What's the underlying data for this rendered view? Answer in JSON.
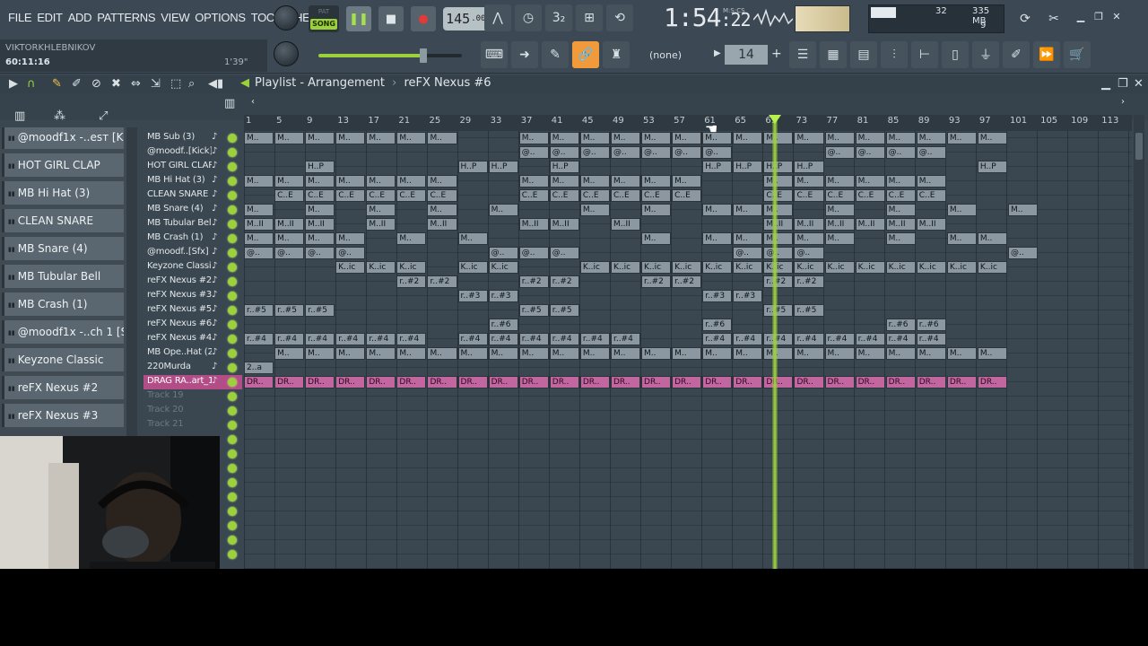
{
  "menu": [
    "FILE",
    "EDIT",
    "ADD",
    "PATTERNS",
    "VIEW",
    "OPTIONS",
    "TOOLS",
    "HELP"
  ],
  "hint": {
    "user": "VIKTORKHLEBNIKOV",
    "time": "60:11:16",
    "duration": "1'39\""
  },
  "transport": {
    "pat_label": "PAT",
    "song_label": "SONG",
    "tempo": "145",
    "tempo_decimal": ".000"
  },
  "clock": {
    "value": "1:54",
    "seconds": ":22",
    "sub": "M:S:CS"
  },
  "cpu": {
    "value": "32",
    "memory": "335 MB",
    "polyphony": "9"
  },
  "pattern_selector": "(none)",
  "step_value": "14",
  "master_volume": 0.73,
  "playlist": {
    "title": "Playlist - Arrangement",
    "separator": "›",
    "pattern": "reFX Nexus #6"
  },
  "ruler": [
    "1",
    "5",
    "9",
    "13",
    "17",
    "21",
    "25",
    "29",
    "33",
    "37",
    "41",
    "45",
    "49",
    "53",
    "57",
    "61",
    "65",
    "69",
    "73",
    "77",
    "81",
    "85",
    "89",
    "93",
    "97",
    "101",
    "105",
    "109",
    "113"
  ],
  "picker": [
    "@moodf1x -..esт [Kick]",
    "HOT GIRL CLAP",
    "MB Hi Hat (3)",
    "CLEAN SNARE",
    "MB Snare (4)",
    "MB Tubular Bell",
    "MB Crash (1)",
    "@moodf1x -..ch 1 [Sfx]",
    "Keyzone Classic",
    "reFX Nexus #2",
    "reFX Nexus #3"
  ],
  "tracks": [
    {
      "name": "MB Sub (3)",
      "clip": "M..",
      "bars": [
        1,
        5,
        9,
        13,
        17,
        21,
        25,
        37,
        41,
        45,
        49,
        53,
        57,
        61,
        65,
        69,
        73,
        77,
        81,
        85,
        89,
        93,
        97
      ]
    },
    {
      "name": "@moodf..[Kick]",
      "clip": "@..",
      "bars": [
        37,
        41,
        45,
        49,
        53,
        57,
        61,
        77,
        81,
        85,
        89
      ]
    },
    {
      "name": "HOT GIRL CLAP",
      "clip": "H..P",
      "bars": [
        9,
        29,
        33,
        41,
        61,
        65,
        69,
        73,
        97
      ]
    },
    {
      "name": "MB Hi Hat (3)",
      "clip": "M..",
      "bars": [
        1,
        5,
        9,
        13,
        17,
        21,
        25,
        37,
        41,
        45,
        49,
        53,
        57,
        69,
        73,
        77,
        81,
        85,
        89
      ]
    },
    {
      "name": "CLEAN SNARE",
      "clip": "C..E",
      "bars": [
        5,
        9,
        13,
        17,
        21,
        25,
        37,
        41,
        45,
        49,
        53,
        57,
        69,
        73,
        77,
        81,
        85,
        89
      ]
    },
    {
      "name": "MB Snare (4)",
      "clip": "M..",
      "bars": [
        1,
        9,
        17,
        25,
        33,
        45,
        53,
        61,
        65,
        69,
        77,
        85,
        93,
        101
      ]
    },
    {
      "name": "MB Tubular Bell",
      "clip": "M..II",
      "bars": [
        1,
        5,
        9,
        17,
        25,
        37,
        41,
        49,
        69,
        73,
        77,
        81,
        85,
        89
      ]
    },
    {
      "name": "MB Crash (1)",
      "clip": "M..",
      "bars": [
        1,
        5,
        9,
        13,
        21,
        29,
        53,
        61,
        65,
        69,
        73,
        77,
        85,
        93,
        97
      ]
    },
    {
      "name": "@moodf..[Sfx]",
      "clip": "@..",
      "bars": [
        1,
        5,
        9,
        13,
        33,
        37,
        41,
        65,
        69,
        73,
        101
      ]
    },
    {
      "name": "Keyzone Classic",
      "clip": "K..ic",
      "bars": [
        13,
        17,
        21,
        29,
        33,
        45,
        49,
        53,
        57,
        61,
        65,
        69,
        73,
        77,
        81,
        85,
        89,
        93,
        97
      ]
    },
    {
      "name": "reFX Nexus #2",
      "clip": "r..#2",
      "bars": [
        21,
        25,
        37,
        41,
        53,
        57,
        69,
        73
      ]
    },
    {
      "name": "reFX Nexus #3",
      "clip": "r..#3",
      "bars": [
        29,
        33,
        61,
        65
      ]
    },
    {
      "name": "reFX Nexus #5",
      "clip": "r..#5",
      "bars": [
        1,
        5,
        9,
        37,
        41,
        69,
        73
      ]
    },
    {
      "name": "reFX Nexus #6",
      "clip": "r..#6",
      "bars": [
        33,
        61,
        85,
        89
      ]
    },
    {
      "name": "reFX Nexus #4",
      "clip": "r..#4",
      "bars": [
        1,
        5,
        9,
        13,
        17,
        21,
        29,
        33,
        37,
        41,
        45,
        49,
        61,
        65,
        69,
        73,
        77,
        81,
        85,
        89
      ]
    },
    {
      "name": "MB Ope..Hat (2)",
      "clip": "M..",
      "bars": [
        5,
        9,
        13,
        17,
        21,
        25,
        29,
        33,
        37,
        41,
        45,
        49,
        53,
        57,
        61,
        65,
        69,
        73,
        77,
        81,
        85,
        89,
        93,
        97
      ]
    },
    {
      "name": "220Murda",
      "clip": "2..a",
      "bars": [
        1
      ]
    },
    {
      "name": "DRAG RA..art_1",
      "clip": "DR..",
      "pink": true,
      "bars": [
        1,
        5,
        9,
        13,
        17,
        21,
        25,
        29,
        33,
        37,
        41,
        45,
        49,
        53,
        57,
        61,
        65,
        69,
        73,
        77,
        81,
        85,
        89,
        93,
        97
      ]
    },
    {
      "name": "Track 19",
      "empty": true,
      "bars": []
    },
    {
      "name": "Track 20",
      "empty": true,
      "bars": []
    },
    {
      "name": "Track 21",
      "empty": true,
      "bars": []
    }
  ],
  "playhead_bar": 70.5,
  "colors": {
    "accent": "#9bd13a",
    "pink_track": "#b24d87",
    "active_tool": "#f19a3b"
  }
}
